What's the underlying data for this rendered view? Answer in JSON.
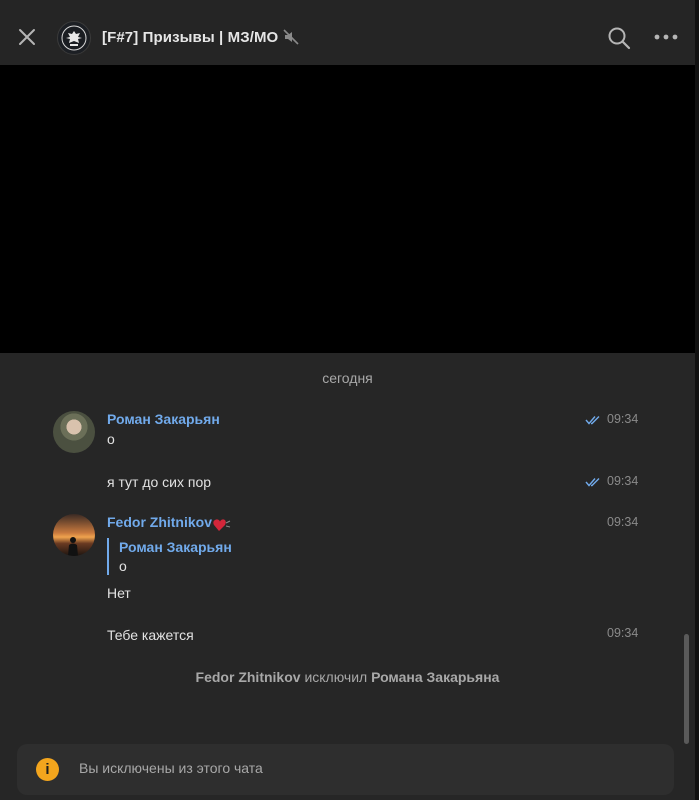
{
  "header": {
    "title": "[F#7] Призывы | МЗ/МО",
    "muted": true
  },
  "date_separator": "сегодня",
  "messages": [
    {
      "author": "Роман Закарьян",
      "text": "о",
      "time": "09:34",
      "read": true
    },
    {
      "author": "Роман Закарьян",
      "text": "я тут до сих пор",
      "time": "09:34",
      "read": true
    },
    {
      "author": "Fedor Zhitnikov",
      "reply_to": {
        "author": "Роман Закарьян",
        "text": "о"
      },
      "text": "Нет",
      "time": "09:34"
    },
    {
      "author": "Fedor Zhitnikov",
      "text": "Тебе кажется",
      "time": "09:34"
    }
  ],
  "service_message": {
    "actor": "Fedor Zhitnikov",
    "action": "исключил",
    "target": "Романа Закарьяна"
  },
  "notice": {
    "icon": "info-icon",
    "text": "Вы исключены из этого чата"
  },
  "colors": {
    "accent": "#71aaeb",
    "warning": "#f3a51d",
    "background": "#262626"
  }
}
